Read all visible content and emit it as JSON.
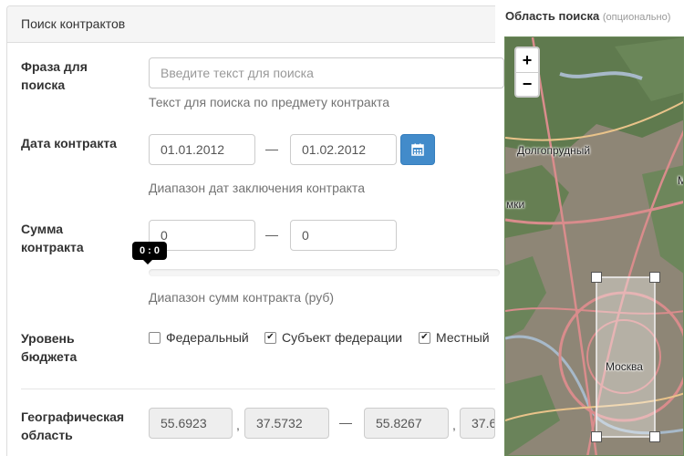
{
  "form": {
    "heading": "Поиск контрактов",
    "phrase": {
      "label": "Фраза для поиска",
      "placeholder": "Введите текст для поиска",
      "help": "Текст для поиска по предмету контракта"
    },
    "date": {
      "label": "Дата контракта",
      "from": "01.01.2012",
      "to": "01.02.2012",
      "separator": "—",
      "calendar_icon": "calendar-icon",
      "help": "Диапазон дат заключения контракта"
    },
    "sum": {
      "label": "Сумма контракта",
      "from": "0",
      "to": "0",
      "separator": "—",
      "tooltip": "0 : 0",
      "help": "Диапазон сумм контракта (руб)"
    },
    "budget": {
      "label": "Уровень бюджета",
      "options": [
        {
          "label": "Федеральный",
          "checked": false
        },
        {
          "label": "Субъект федерации",
          "checked": true
        },
        {
          "label": "Местный",
          "checked": true
        }
      ]
    },
    "geo": {
      "label": "Географическая область",
      "lat_from": "55.6923",
      "lon_from": "37.5732",
      "separator": "—",
      "comma": ",",
      "lat_to": "55.8267",
      "lon_to": "37.6"
    }
  },
  "map": {
    "title": "Область поиска",
    "subtitle": "(опционально)",
    "zoom_in": "+",
    "zoom_out": "−",
    "labels": {
      "dolgoprudny": "Долгопрудный",
      "khimki": "мки",
      "moskva": "Москва",
      "m": "М"
    },
    "colors": {
      "forest": "#5f7a4e",
      "urban": "#9a8f80",
      "road": "#d98c8c",
      "water": "#a7b9c9",
      "selection": "#ffffff"
    }
  }
}
